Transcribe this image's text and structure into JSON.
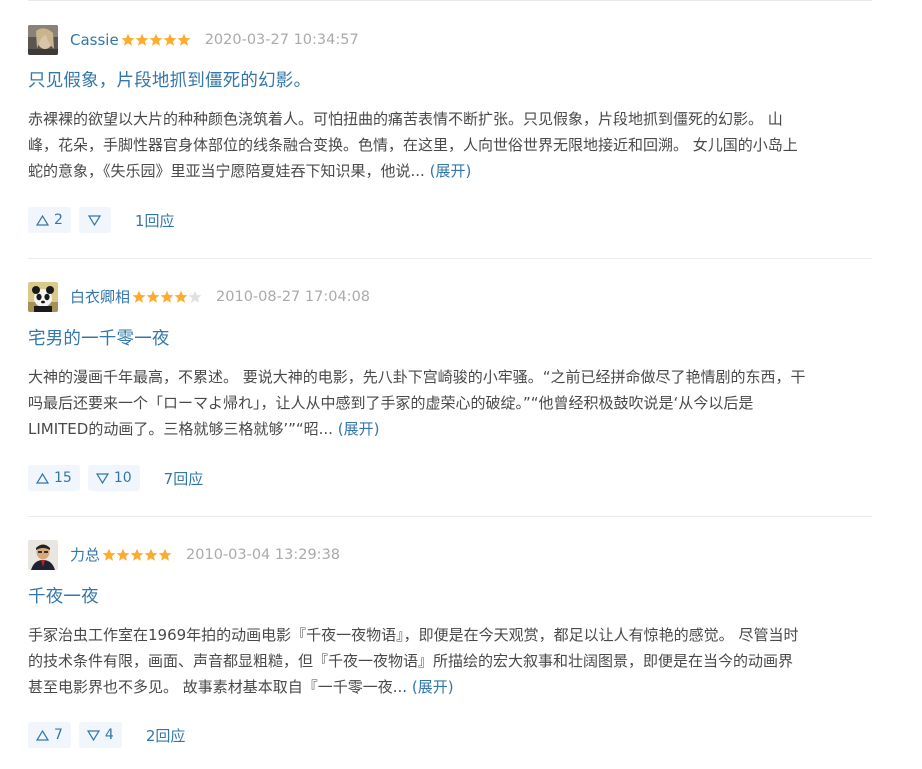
{
  "reviews": [
    {
      "author": "Cassie",
      "rating": 5,
      "time": "2020-03-27 10:34:57",
      "title": "只见假象，片段地抓到僵死的幻影。",
      "lines": [
        "赤裸裸的欲望以大片的种种颜色浇筑着人。可怕扭曲的痛苦表情不断扩张。只见假象，片段地抓到僵死的幻影。 山",
        "峰，花朵，手脚性器官身体部位的线条融合变换。色情，在这里，人向世俗世界无限地接近和回溯。 女儿国的小岛上",
        "蛇的意象，《失乐园》里亚当宁愿陪夏娃吞下知识果，他说..."
      ],
      "expand": "(展开)",
      "useful": "2",
      "useless": "",
      "replies": "1回应"
    },
    {
      "author": "白衣卿相",
      "rating": 4,
      "time": "2010-08-27 17:04:08",
      "title": "宅男的一千零一夜",
      "lines": [
        "大神的漫画千年最高，不累述。 要说大神的电影，先八卦下宫崎骏的小牢骚。“之前已经拼命做尽了艳情剧的东西，干",
        "吗最后还要来一个「ローマよ帰れ」，让人从中感到了手冢的虚荣心的破绽。”“他曾经积极鼓吹说是‘从今以后是",
        "LIMITED的动画了。三格就够三格就够’”“昭..."
      ],
      "expand": "(展开)",
      "useful": "15",
      "useless": "10",
      "replies": "7回应"
    },
    {
      "author": "力总",
      "rating": 5,
      "time": "2010-03-04 13:29:38",
      "title": "千夜一夜",
      "lines": [
        "手冢治虫工作室在1969年拍的动画电影『千夜一夜物语』，即便是在今天观赏，都足以让人有惊艳的感觉。 尽管当时",
        "的技术条件有限，画面、声音都显粗糙，但『千夜一夜物语』所描绘的宏大叙事和壮阔图景，即便是在当今的动画界",
        "甚至电影界也不多见。 故事素材基本取自『一千零一夜..."
      ],
      "expand": "(展开)",
      "useful": "7",
      "useless": "4",
      "replies": "2回应"
    }
  ],
  "colors": {
    "link": "#3377aa",
    "text": "#494949",
    "muted": "#aaaaaa",
    "star": "#ffac2d",
    "vote_bg": "#f0f6fb"
  },
  "icons": {
    "useful": "triangle-up-icon",
    "useless": "triangle-down-icon",
    "rating": "star-icon"
  }
}
